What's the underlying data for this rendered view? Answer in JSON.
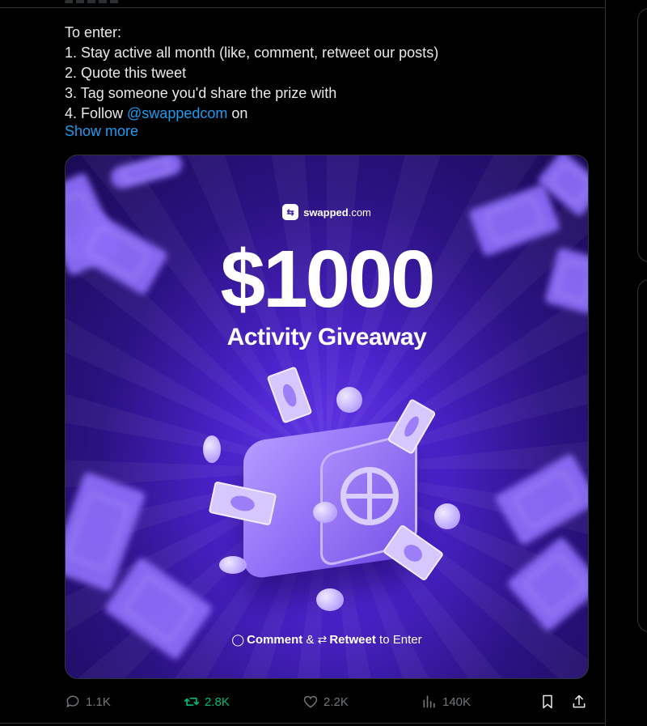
{
  "tweet": {
    "lines": [
      "To enter:",
      "1. Stay active all month (like, comment, retweet our posts)",
      "2. Quote this tweet",
      "3. Tag someone you'd share the prize with"
    ],
    "line4_prefix": "4. Follow ",
    "mention": "@swappedcom",
    "line4_suffix": " on",
    "show_more": "Show more"
  },
  "media": {
    "brand_name_bold": "swapped",
    "brand_name_rest": ".com",
    "brand_logo_glyph": "⇆",
    "amount": "$1000",
    "subtitle": "Activity Giveaway",
    "cta_comment": "Comment",
    "cta_and": " & ",
    "cta_retweet": "Retweet",
    "cta_tail": " to Enter"
  },
  "actions": {
    "replies": "1.1K",
    "retweets": "2.8K",
    "likes": "2.2K",
    "views": "140K"
  },
  "colors": {
    "background": "#000000",
    "text": "#e7e9ea",
    "link": "#1d9bf0",
    "muted": "#71767b",
    "retweet_active": "#00ba7c",
    "media_purple": "#4a22c9"
  }
}
